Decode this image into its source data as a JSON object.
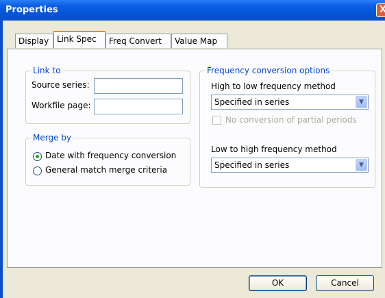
{
  "window": {
    "title": "Properties",
    "close_glyph": "X"
  },
  "tabs": [
    {
      "label": "Display"
    },
    {
      "label": "Link Spec"
    },
    {
      "label": "Freq Convert"
    },
    {
      "label": "Value Map"
    }
  ],
  "link_to": {
    "legend": "Link to",
    "source_label": "Source series:",
    "source_value": "",
    "page_label": "Workfile page:",
    "page_value": ""
  },
  "merge_by": {
    "legend": "Merge by",
    "options": [
      {
        "label": "Date with frequency conversion",
        "selected": true
      },
      {
        "label": "General match merge criteria",
        "selected": false
      }
    ]
  },
  "freq_options": {
    "legend": "Frequency conversion options",
    "high_to_low_label": "High to low frequency method",
    "high_to_low_value": "Specified in series",
    "no_partial_label": "No conversion of partial periods",
    "low_to_high_label": "Low to high frequency method",
    "low_to_high_value": "Specified in series"
  },
  "buttons": {
    "ok": "OK",
    "cancel": "Cancel"
  },
  "colors": {
    "accent_tab": "#e68b2c",
    "group_label": "#0046d5",
    "titlebar": "#0a5de3"
  },
  "icons": {
    "close": "close-icon",
    "dropdown": "chevron-down-icon"
  }
}
